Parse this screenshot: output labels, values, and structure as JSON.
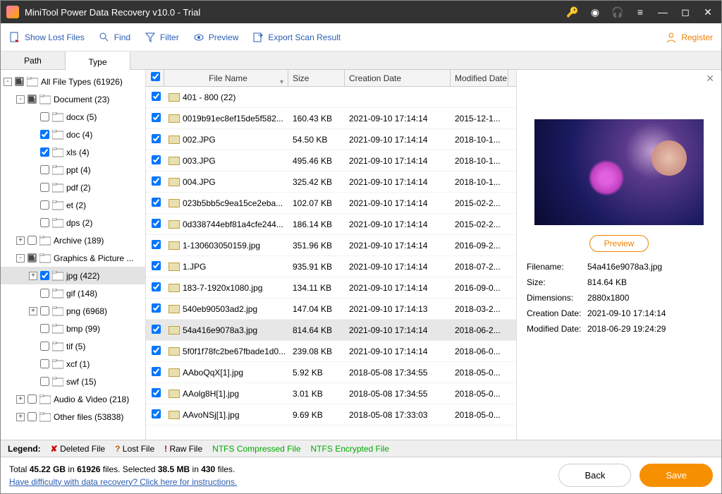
{
  "titlebar": {
    "title": "MiniTool Power Data Recovery v10.0 - Trial"
  },
  "toolbar": {
    "show_lost": "Show Lost Files",
    "find": "Find",
    "filter": "Filter",
    "preview": "Preview",
    "export": "Export Scan Result",
    "register": "Register"
  },
  "tabs": {
    "path": "Path",
    "type": "Type"
  },
  "tree": [
    {
      "ind": 0,
      "exp": "-",
      "chk": "half",
      "label": "All File Types (61926)"
    },
    {
      "ind": 1,
      "exp": "-",
      "chk": "half",
      "label": "Document (23)"
    },
    {
      "ind": 2,
      "exp": "",
      "chk": false,
      "label": "docx (5)"
    },
    {
      "ind": 2,
      "exp": "",
      "chk": true,
      "label": "doc (4)"
    },
    {
      "ind": 2,
      "exp": "",
      "chk": true,
      "label": "xls (4)"
    },
    {
      "ind": 2,
      "exp": "",
      "chk": false,
      "label": "ppt (4)"
    },
    {
      "ind": 2,
      "exp": "",
      "chk": false,
      "label": "pdf (2)"
    },
    {
      "ind": 2,
      "exp": "",
      "chk": false,
      "label": "et (2)"
    },
    {
      "ind": 2,
      "exp": "",
      "chk": false,
      "label": "dps (2)"
    },
    {
      "ind": 1,
      "exp": "+",
      "chk": false,
      "label": "Archive (189)"
    },
    {
      "ind": 1,
      "exp": "-",
      "chk": "half",
      "label": "Graphics & Picture ..."
    },
    {
      "ind": 2,
      "exp": "+",
      "chk": true,
      "label": "jpg (422)",
      "selected": true
    },
    {
      "ind": 2,
      "exp": "",
      "chk": false,
      "label": "gif (148)"
    },
    {
      "ind": 2,
      "exp": "+",
      "chk": false,
      "label": "png (6968)"
    },
    {
      "ind": 2,
      "exp": "",
      "chk": false,
      "label": "bmp (99)"
    },
    {
      "ind": 2,
      "exp": "",
      "chk": false,
      "label": "tif (5)"
    },
    {
      "ind": 2,
      "exp": "",
      "chk": false,
      "label": "xcf (1)"
    },
    {
      "ind": 2,
      "exp": "",
      "chk": false,
      "label": "swf (15)"
    },
    {
      "ind": 1,
      "exp": "+",
      "chk": false,
      "label": "Audio & Video (218)"
    },
    {
      "ind": 1,
      "exp": "+",
      "chk": false,
      "label": "Other files (53838)"
    }
  ],
  "columns": {
    "name": "File Name",
    "size": "Size",
    "cdate": "Creation Date",
    "mdate": "Modified Date"
  },
  "files": [
    {
      "name": "401 - 800 (22)",
      "size": "",
      "cdate": "",
      "mdate": "",
      "group": true
    },
    {
      "name": "0019b91ec8ef15de5f582...",
      "size": "160.43 KB",
      "cdate": "2021-09-10 17:14:14",
      "mdate": "2015-12-1..."
    },
    {
      "name": "002.JPG",
      "size": "54.50 KB",
      "cdate": "2021-09-10 17:14:14",
      "mdate": "2018-10-1..."
    },
    {
      "name": "003.JPG",
      "size": "495.46 KB",
      "cdate": "2021-09-10 17:14:14",
      "mdate": "2018-10-1..."
    },
    {
      "name": "004.JPG",
      "size": "325.42 KB",
      "cdate": "2021-09-10 17:14:14",
      "mdate": "2018-10-1..."
    },
    {
      "name": "023b5bb5c9ea15ce2eba...",
      "size": "102.07 KB",
      "cdate": "2021-09-10 17:14:14",
      "mdate": "2015-02-2..."
    },
    {
      "name": "0d338744ebf81a4cfe244...",
      "size": "186.14 KB",
      "cdate": "2021-09-10 17:14:14",
      "mdate": "2015-02-2..."
    },
    {
      "name": "1-130603050159.jpg",
      "size": "351.96 KB",
      "cdate": "2021-09-10 17:14:14",
      "mdate": "2016-09-2..."
    },
    {
      "name": "1.JPG",
      "size": "935.91 KB",
      "cdate": "2021-09-10 17:14:14",
      "mdate": "2018-07-2..."
    },
    {
      "name": "183-7-1920x1080.jpg",
      "size": "134.11 KB",
      "cdate": "2021-09-10 17:14:14",
      "mdate": "2016-09-0..."
    },
    {
      "name": "540eb90503ad2.jpg",
      "size": "147.04 KB",
      "cdate": "2021-09-10 17:14:13",
      "mdate": "2018-03-2..."
    },
    {
      "name": "54a416e9078a3.jpg",
      "size": "814.64 KB",
      "cdate": "2021-09-10 17:14:14",
      "mdate": "2018-06-2...",
      "selected": true
    },
    {
      "name": "5f0f1f78fc2be67fbade1d0...",
      "size": "239.08 KB",
      "cdate": "2021-09-10 17:14:14",
      "mdate": "2018-06-0..."
    },
    {
      "name": "AAboQqX[1].jpg",
      "size": "5.92 KB",
      "cdate": "2018-05-08 17:34:55",
      "mdate": "2018-05-0..."
    },
    {
      "name": "AAolg8H[1].jpg",
      "size": "3.01 KB",
      "cdate": "2018-05-08 17:34:55",
      "mdate": "2018-05-0..."
    },
    {
      "name": "AAvoNSj[1].jpg",
      "size": "9.69 KB",
      "cdate": "2018-05-08 17:33:03",
      "mdate": "2018-05-0..."
    }
  ],
  "preview": {
    "button": "Preview",
    "labels": {
      "fn": "Filename:",
      "sz": "Size:",
      "dim": "Dimensions:",
      "cd": "Creation Date:",
      "md": "Modified Date:"
    },
    "values": {
      "fn": "54a416e9078a3.jpg",
      "sz": "814.64 KB",
      "dim": "2880x1800",
      "cd": "2021-09-10 17:14:14",
      "md": "2018-06-29 19:24:29"
    }
  },
  "legend": {
    "label": "Legend:",
    "del": "Deleted File",
    "lost": "Lost File",
    "raw": "Raw File",
    "compressed": "NTFS Compressed File",
    "encrypted": "NTFS Encrypted File"
  },
  "footer": {
    "summary_1": "Total ",
    "summary_2": "45.22 GB",
    "summary_3": " in ",
    "summary_4": "61926",
    "summary_5": " files.   Selected ",
    "summary_6": "38.5 MB",
    "summary_7": " in ",
    "summary_8": "430",
    "summary_9": " files.",
    "help": "Have difficulty with data recovery? Click here for instructions.",
    "back": "Back",
    "save": "Save"
  }
}
